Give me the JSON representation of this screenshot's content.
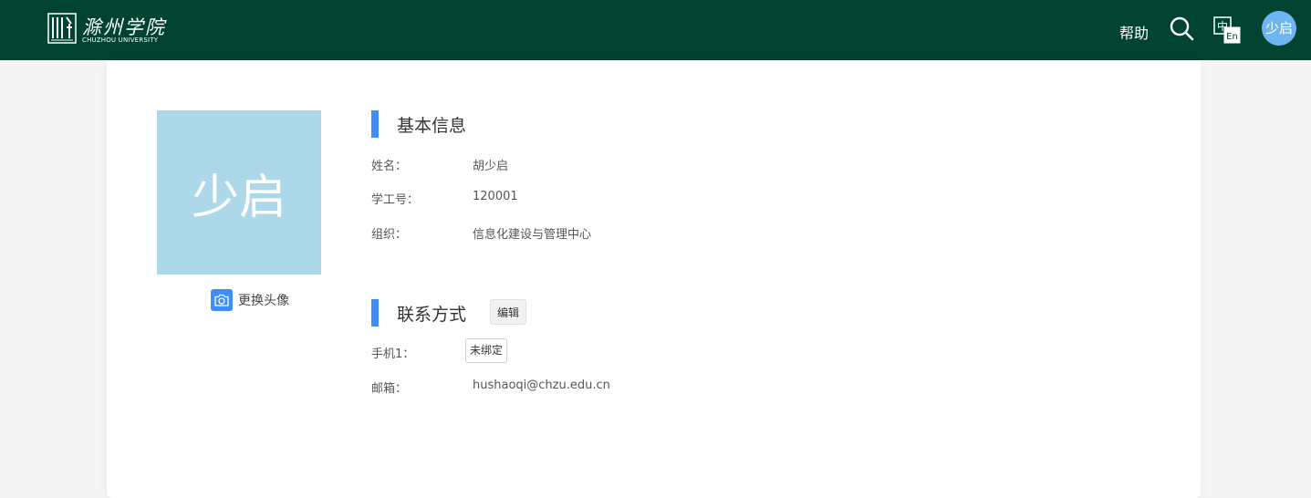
{
  "header": {
    "logo_cn": "滁州学院",
    "logo_en": "CHUZHOU UNIVERSITY",
    "help_label": "帮助",
    "search_icon": "search-icon",
    "language_icon": "language-switch-icon",
    "user_avatar_text": "少启",
    "background_color": "#004330"
  },
  "profile": {
    "avatar_text": "少启",
    "avatar_color": "#acd8ea",
    "change_avatar_label": "更换头像",
    "camera_icon": "camera-icon"
  },
  "basic_info": {
    "title": "基本信息",
    "name_label": "姓名：",
    "name_value": "胡少启",
    "id_label": "学工号：",
    "id_value": "120001",
    "org_label": "组织：",
    "org_value": "信息化建设与管理中心"
  },
  "contact": {
    "title": "联系方式",
    "edit_label": "编辑",
    "phone_label": "手机1：",
    "phone_status": "未绑定",
    "email_label": "邮箱：",
    "email_value": "hushaoqi@chzu.edu.cn"
  },
  "accent_color": "#3e8ef7"
}
